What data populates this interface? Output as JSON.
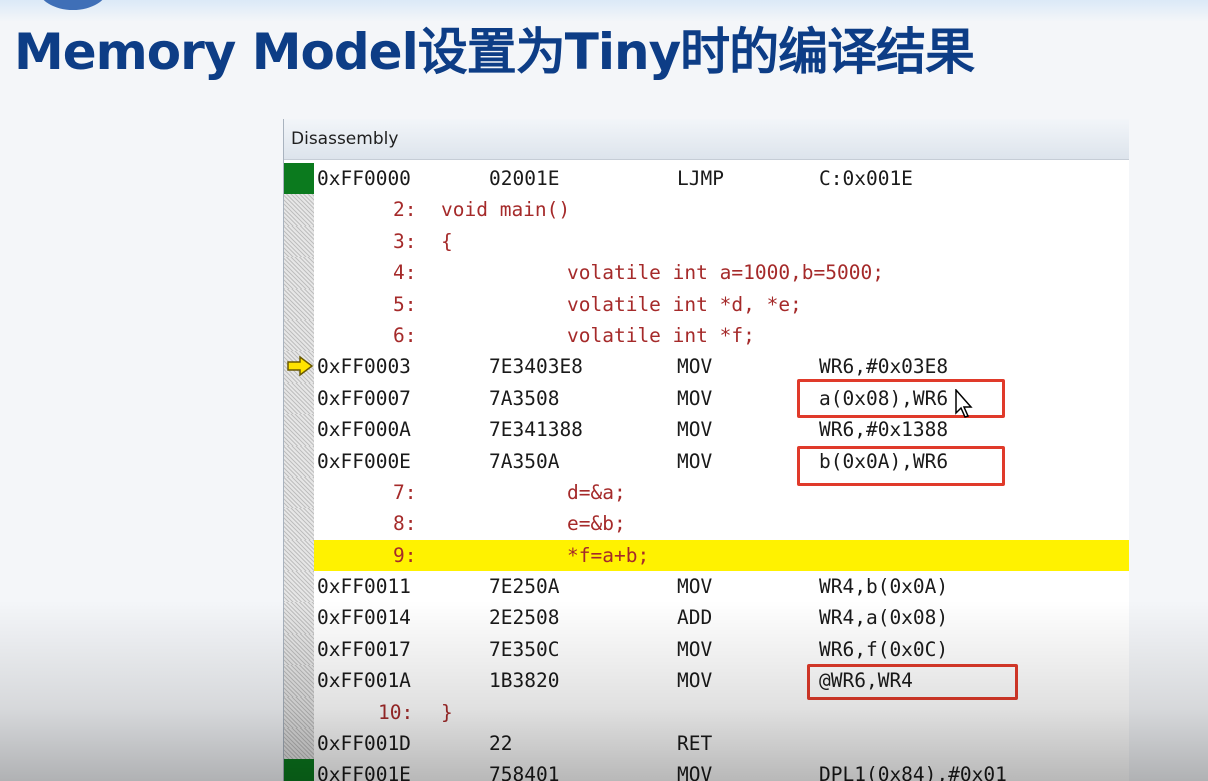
{
  "slide": {
    "title": "Memory Model设置为Tiny时的编译结果"
  },
  "window": {
    "title": "Disassembly"
  },
  "colors": {
    "title": "#0d3d86",
    "source_text": "#a52a2a",
    "asm_text": "#1a1a1a",
    "current_line": "#fff200",
    "exec_marker": "#0b7a1e",
    "annotation_box": "#e03a2a"
  },
  "rows": [
    {
      "kind": "asm",
      "addr": "0xFF0000",
      "code": "02001E",
      "mnem": "LJMP",
      "ops": "C:0x001E",
      "marker": "exec"
    },
    {
      "kind": "src",
      "line": "2:",
      "stmt": "void main()"
    },
    {
      "kind": "src",
      "line": "3:",
      "stmt": "{"
    },
    {
      "kind": "src",
      "line": "4:",
      "body": "volatile int a=1000,b=5000;"
    },
    {
      "kind": "src",
      "line": "5:",
      "body": "volatile int *d, *e;"
    },
    {
      "kind": "src",
      "line": "6:",
      "body": "volatile int *f;"
    },
    {
      "kind": "asm",
      "addr": "0xFF0003",
      "code": "7E3403E8",
      "mnem": "MOV",
      "ops": "WR6,#0x03E8",
      "marker": "arrow",
      "marker_icon": "current-instruction-arrow-icon"
    },
    {
      "kind": "asm",
      "addr": "0xFF0007",
      "code": "7A3508",
      "mnem": "MOV",
      "ops": "a(0x08),WR6"
    },
    {
      "kind": "asm",
      "addr": "0xFF000A",
      "code": "7E341388",
      "mnem": "MOV",
      "ops": "WR6,#0x1388"
    },
    {
      "kind": "asm",
      "addr": "0xFF000E",
      "code": "7A350A",
      "mnem": "MOV",
      "ops": "b(0x0A),WR6"
    },
    {
      "kind": "src",
      "line": "7:",
      "body": "d=&a;"
    },
    {
      "kind": "src",
      "line": "8:",
      "body": "e=&b;"
    },
    {
      "kind": "src",
      "line": "9:",
      "body": "*f=a+b;",
      "highlight": true
    },
    {
      "kind": "asm",
      "addr": "0xFF0011",
      "code": "7E250A",
      "mnem": "MOV",
      "ops": "WR4,b(0x0A)"
    },
    {
      "kind": "asm",
      "addr": "0xFF0014",
      "code": "2E2508",
      "mnem": "ADD",
      "ops": "WR4,a(0x08)"
    },
    {
      "kind": "asm",
      "addr": "0xFF0017",
      "code": "7E350C",
      "mnem": "MOV",
      "ops": "WR6,f(0x0C)"
    },
    {
      "kind": "asm",
      "addr": "0xFF001A",
      "code": "1B3820",
      "mnem": "MOV",
      "ops": "@WR6,WR4"
    },
    {
      "kind": "src",
      "line": "10:",
      "stmt": "}",
      "wide": true
    },
    {
      "kind": "asm",
      "addr": "0xFF001D",
      "code": "22",
      "mnem": "RET",
      "ops": ""
    },
    {
      "kind": "asm",
      "addr": "0xFF001E",
      "code": "758401",
      "mnem": "MOV",
      "ops": "DPL1(0x84),#0x01",
      "marker": "exec"
    }
  ]
}
